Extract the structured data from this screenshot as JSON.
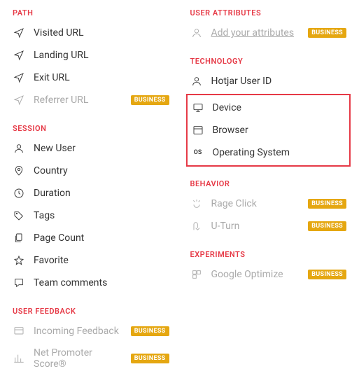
{
  "badge_label": "BUSINESS",
  "left": {
    "path": {
      "header": "PATH",
      "items": [
        {
          "label": "Visited URL"
        },
        {
          "label": "Landing URL"
        },
        {
          "label": "Exit URL"
        },
        {
          "label": "Referrer URL",
          "badge": true,
          "disabled": true
        }
      ]
    },
    "session": {
      "header": "SESSION",
      "items": [
        {
          "label": "New User"
        },
        {
          "label": "Country"
        },
        {
          "label": "Duration"
        },
        {
          "label": "Tags"
        },
        {
          "label": "Page Count"
        },
        {
          "label": "Favorite"
        },
        {
          "label": "Team comments"
        }
      ]
    },
    "user_feedback": {
      "header": "USER FEEDBACK",
      "items": [
        {
          "label": "Incoming Feedback",
          "badge": true,
          "disabled": true
        },
        {
          "label": "Net Promoter Score®",
          "badge": true,
          "disabled": true
        }
      ]
    }
  },
  "right": {
    "user_attributes": {
      "header": "USER ATTRIBUTES",
      "items": [
        {
          "label": "Add your attributes",
          "badge": true,
          "disabled": true,
          "underline": true
        }
      ]
    },
    "technology": {
      "header": "TECHNOLOGY",
      "items": [
        {
          "label": "Hotjar User ID"
        },
        {
          "label": "Device",
          "highlight": true
        },
        {
          "label": "Browser",
          "highlight": true
        },
        {
          "label": "Operating System",
          "highlight": true
        }
      ]
    },
    "behavior": {
      "header": "BEHAVIOR",
      "items": [
        {
          "label": "Rage Click",
          "badge": true,
          "disabled": true
        },
        {
          "label": "U-Turn",
          "badge": true,
          "disabled": true
        }
      ]
    },
    "experiments": {
      "header": "EXPERIMENTS",
      "items": [
        {
          "label": "Google Optimize",
          "badge": true,
          "disabled": true
        }
      ]
    }
  }
}
